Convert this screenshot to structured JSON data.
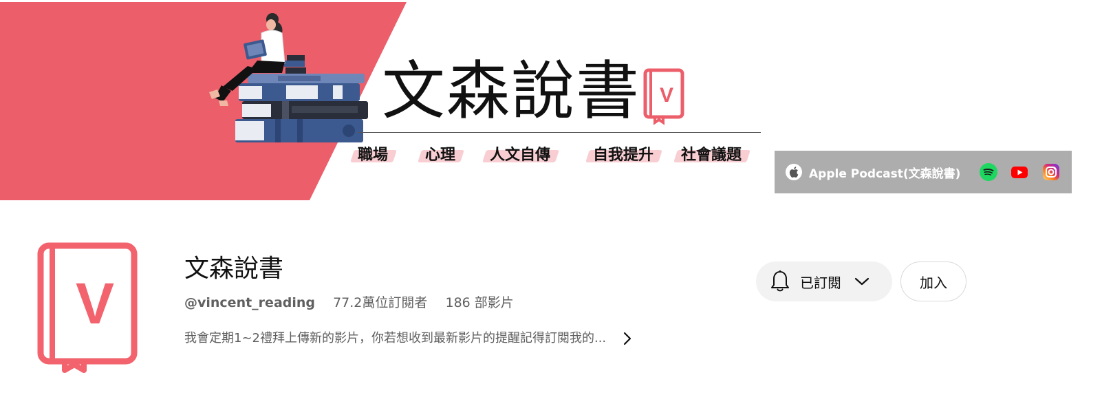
{
  "banner": {
    "title": "文森說書",
    "logo_letter": "V",
    "tags": [
      "職場",
      "心理",
      "人文自傳",
      "自我提升",
      "社會議題"
    ],
    "accent_color": "#eb5e6a"
  },
  "links": {
    "main_label": "Apple Podcast(文森說書)",
    "icons": [
      "apple-icon",
      "spotify-icon",
      "youtube-icon",
      "instagram-icon"
    ]
  },
  "channel": {
    "avatar_letter": "V",
    "name": "文森說書",
    "handle": "@vincent_reading",
    "subscribers": "77.2萬位訂閱者",
    "videos": "186 部影片",
    "description": "我會定期1~2禮拜上傳新的影片，你若想收到最新影片的提醒記得訂閱我的..."
  },
  "actions": {
    "subscribed_label": "已訂閱",
    "join_label": "加入"
  }
}
